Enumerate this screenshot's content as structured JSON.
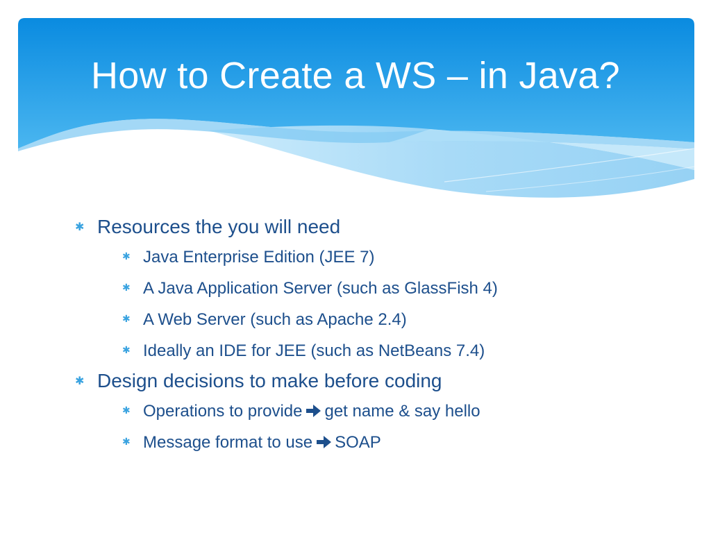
{
  "slide": {
    "title": "How to Create a WS – in Java?",
    "colors": {
      "header_top": "#0a8be0",
      "header_bottom": "#47b4ef",
      "wave_light": "#a8dcf7",
      "text": "#1d4f8c",
      "bullet": "#3aa3e0"
    },
    "bullets": [
      {
        "text": "Resources the you will need",
        "children": [
          {
            "text": "Java Enterprise Edition (JEE 7)"
          },
          {
            "text": "A Java Application Server (such as GlassFish 4)"
          },
          {
            "text": "A Web Server (such as Apache 2.4)"
          },
          {
            "text": "Ideally an IDE for JEE (such as NetBeans 7.4)"
          }
        ]
      },
      {
        "text": "Design decisions to make before coding",
        "children": [
          {
            "before": "Operations to provide",
            "after": "get name & say hello"
          },
          {
            "before": "Message format to use",
            "after": "SOAP"
          }
        ]
      }
    ],
    "bullet_glyph": "✱",
    "arrow_icon": "bold-right-arrow-icon"
  }
}
